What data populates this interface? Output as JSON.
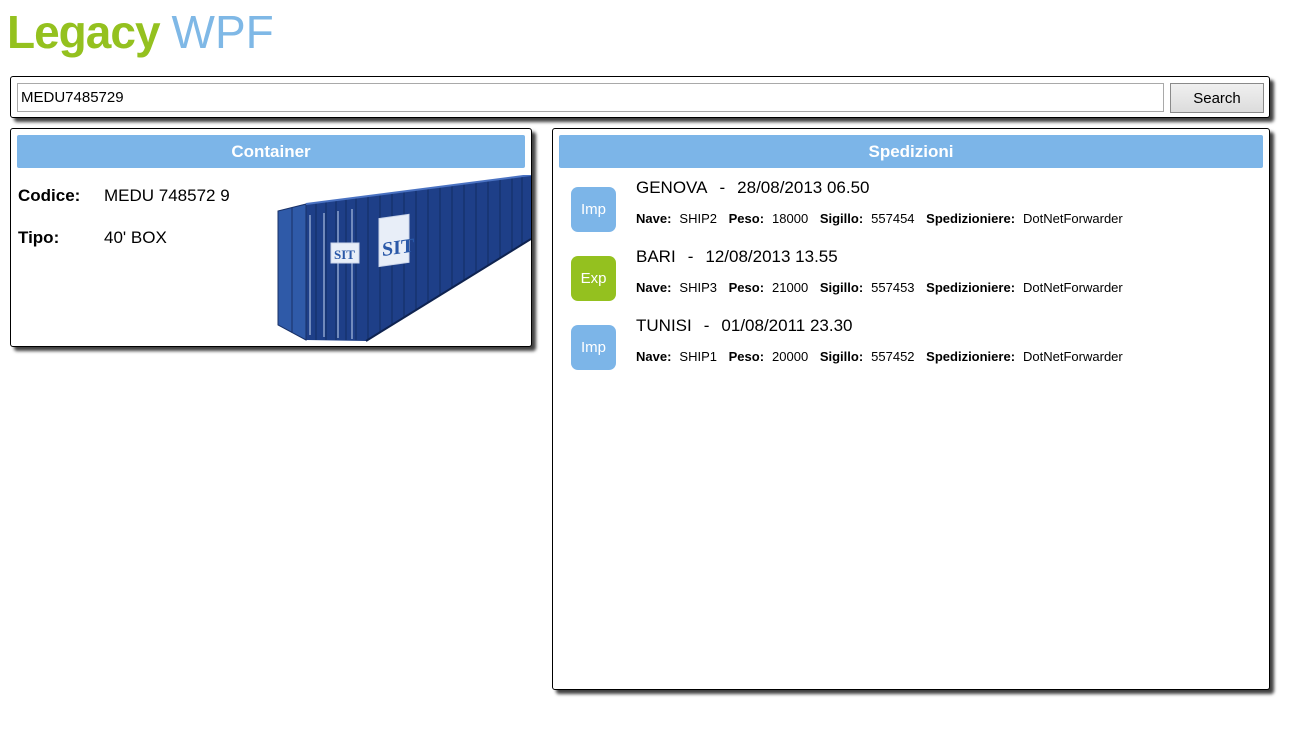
{
  "app": {
    "title_part1": "Legacy",
    "title_part2": "WPF"
  },
  "search": {
    "value": "MEDU7485729",
    "button_label": "Search"
  },
  "container": {
    "header": "Container",
    "codice_label": "Codice:",
    "codice_value": "MEDU 748572 9",
    "tipo_label": "Tipo:",
    "tipo_value": "40' BOX",
    "image_logo_text": "SIT"
  },
  "spedizioni": {
    "header": "Spedizioni",
    "detail_labels": {
      "nave": "Nave:",
      "peso": "Peso:",
      "sigillo": "Sigillo:",
      "spedizioniere": "Spedizioniere:"
    },
    "items": [
      {
        "type": "Imp",
        "port": "GENOVA",
        "separator": "-",
        "datetime": "28/08/2013 06.50",
        "nave": "SHIP2",
        "peso": "18000",
        "sigillo": "557454",
        "spedizioniere": "DotNetForwarder"
      },
      {
        "type": "Exp",
        "port": "BARI",
        "separator": "-",
        "datetime": "12/08/2013 13.55",
        "nave": "SHIP3",
        "peso": "21000",
        "sigillo": "557453",
        "spedizioniere": "DotNetForwarder"
      },
      {
        "type": "Imp",
        "port": "TUNISI",
        "separator": "-",
        "datetime": "01/08/2011 23.30",
        "nave": "SHIP1",
        "peso": "20000",
        "sigillo": "557452",
        "spedizioniere": "DotNetForwarder"
      }
    ]
  },
  "colors": {
    "accent_blue": "#7cb5e8",
    "accent_green": "#94c11f"
  }
}
